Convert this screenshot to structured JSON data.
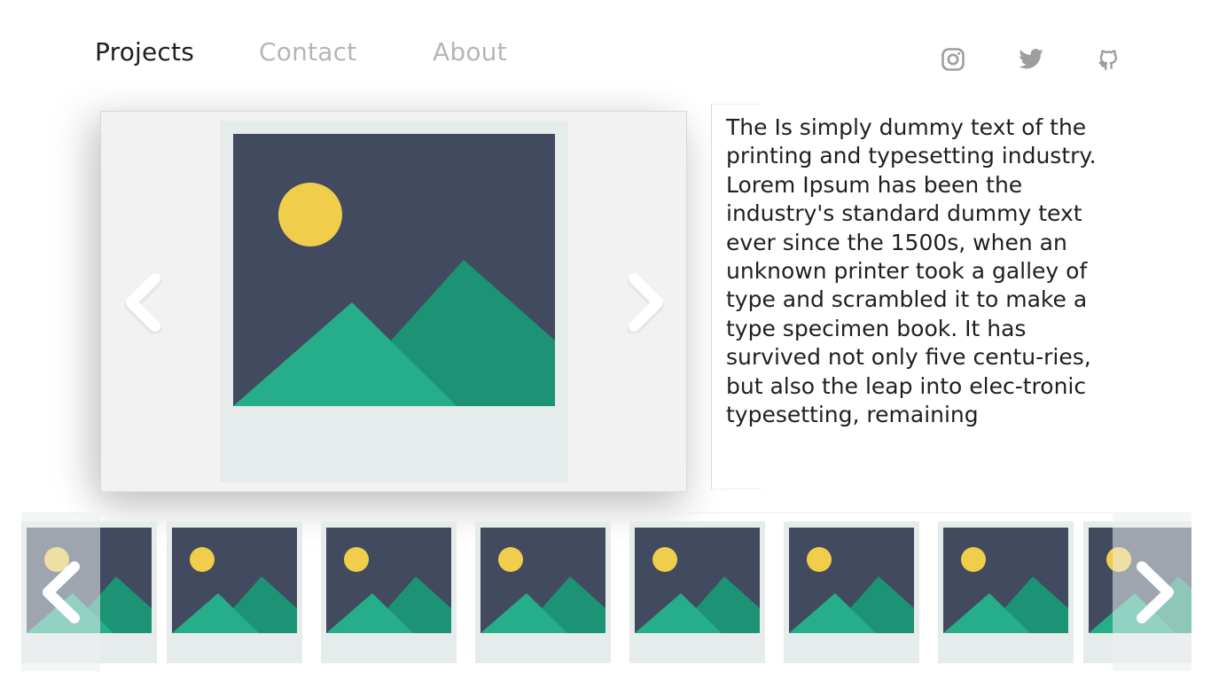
{
  "nav": {
    "items": [
      {
        "label": "Projects",
        "active": true
      },
      {
        "label": "Contact",
        "active": false
      },
      {
        "label": "About",
        "active": false
      }
    ]
  },
  "social": {
    "icons": [
      "instagram-icon",
      "twitter-icon",
      "github-icon"
    ],
    "color": "#9e9e9e"
  },
  "viewer": {
    "image": "landscape-placeholder-image",
    "prev_icon": "chevron-left-icon",
    "next_icon": "chevron-right-icon"
  },
  "description": {
    "text": "The Is simply dummy text of the printing and typesetting industry. Lorem Ipsum has been the industry's standard dummy text ever since the 1500s, when an unknown printer took a galley of type and scrambled it to make a type specimen book. It has survived not only five centu-ries, but also the leap into elec-tronic typesetting, remaining"
  },
  "thumbnails": {
    "count": 8,
    "image": "landscape-placeholder-image"
  },
  "colors": {
    "sky": "#424a5f",
    "sun": "#f0cd4b",
    "mountain_back": "#1c9374",
    "mountain_front": "#25ae89",
    "frame": "#e6ebec",
    "text_active": "#1f1f1f",
    "text_inactive": "#b6b6b6"
  }
}
